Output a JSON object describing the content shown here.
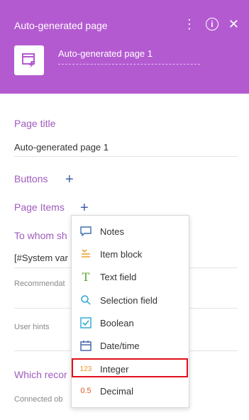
{
  "header": {
    "title": "Auto-generated page",
    "page_name": "Auto-generated page 1"
  },
  "form": {
    "page_title_label": "Page title",
    "page_title_value": "Auto-generated page 1",
    "buttons_label": "Buttons",
    "page_items_label": "Page Items",
    "to_whom_label": "To whom sh",
    "system_var_prefix": "[#System var",
    "system_var_suffix": "]",
    "recommendations_label": "Recommendat",
    "user_hints_label": "User hints",
    "which_records_label": "Which recor",
    "connected_label": "Connected ob"
  },
  "menu": {
    "items": [
      {
        "label": "Notes",
        "icon": "notes-icon"
      },
      {
        "label": "Item block",
        "icon": "item-block-icon"
      },
      {
        "label": "Text field",
        "icon": "text-field-icon"
      },
      {
        "label": "Selection field",
        "icon": "selection-field-icon"
      },
      {
        "label": "Boolean",
        "icon": "boolean-icon"
      },
      {
        "label": "Date/time",
        "icon": "date-time-icon"
      },
      {
        "label": "Integer",
        "icon": "integer-icon",
        "icon_text": "123"
      },
      {
        "label": "Decimal",
        "icon": "decimal-icon",
        "icon_text": "0.5"
      }
    ],
    "highlighted_item": "Integer"
  },
  "colors": {
    "header_bg": "#b45ad1",
    "section_label": "#a05bbf",
    "plus": "#3f5fa8",
    "highlight": "#e0101a"
  }
}
